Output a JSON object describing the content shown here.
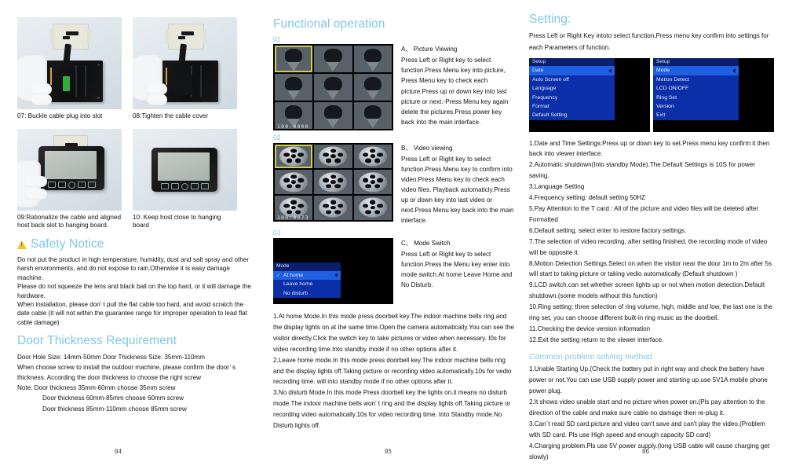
{
  "left_column": {
    "photos": [
      {
        "id": "07",
        "caption": "07:  Buckle cable plug into slot"
      },
      {
        "id": "08",
        "caption": "08:Tighten the cable cover"
      },
      {
        "id": "09",
        "caption": "09:Rationalize the cable and aligned host back slot to hanging board."
      },
      {
        "id": "10",
        "caption": "10: Keep host close to hanging board"
      }
    ],
    "safety": {
      "heading": "Safety Notice",
      "icon": "warning-triangle-icon",
      "paragraphs": [
        "Do not put the product in high temperature, humidity, dust and salt spray and other harsh environments, and do not expose to rain.Otherwise it is easy damage machine.",
        "Please do not squeeze the lens and black ball on the top hard, or it will damage the hardware.",
        "When installation, please don’ t pull the flat cable too hard, and avoid scratch the date cable (it will not within the guarantee range for improper operation to lead flat cable damage)"
      ]
    },
    "door": {
      "heading": "Door Thickness Requirement",
      "line1": "Door Hole Size: 14mm-50mm    Door Thickness Size: 35mm-110mm",
      "line2": "When choose screw to install the outdoor machine, please confirm the door’ s",
      "line3": "thickness. According the door thickness to choose the right screw",
      "note1": "Note:  Door thickness 35mm-60mm    choose 35mm screw",
      "note2": "Door thickness 60mm-85mm    choose 60mm screw",
      "note3": "Door thickness 85mm-110mm    choose 85mm screw"
    },
    "page_number": "04"
  },
  "mid_column": {
    "heading": "Functional operation",
    "sections": [
      {
        "step": "01",
        "screen_type": "picture-thumbnail-grid",
        "file_code": "100-0000",
        "title": "A、 Picture Viewing",
        "body": "Press Left or Right key to select function.Press Menu key into picture, Press Menu key to check each picture.Press up or down key into last picture or next.-Press Menu key again delete the pictures.Press power key back into the main interface."
      },
      {
        "step": "02",
        "screen_type": "video-thumbnail-grid",
        "file_code": "100-0073",
        "title": "B、 Video viewing",
        "body": "Press Left or Right key to select function.Press Menu key to confirm into video.Press Menu key to check each video files. Playback automaticly.Press up or down key into last video or next.Press Menu key back into the main interface."
      },
      {
        "step": "03",
        "screen_type": "mode-osd-menu",
        "osd": {
          "title": "Mode",
          "items": [
            {
              "label": "At home",
              "selected": true,
              "checked": true
            },
            {
              "label": "Leave home",
              "selected": false,
              "checked": false
            },
            {
              "label": "No disturb",
              "selected": false,
              "checked": false
            }
          ]
        },
        "title": "C、 Mode Switch",
        "body": "Press Left or Right key to select function.Press the Menu key enter  into mode switch.At home Leave Home and No Disturb."
      }
    ],
    "modes": [
      "1.At home Mode.In this mode press doorbell key.The indoor machine  bells ring.and the display lights on at the same time.Open the camera automatically.You can see the visitor directly.Click the switch key to take pictures or video when necessary. I0s for video recording time.Into standby mode if no other options after it.",
      "2.Leave home mode.In this mode press doorbell key.The indoor machine  bells ring and the display  lights off.Taking picture or recording video automatically.10s for vedio recording time. will into standby mode if no other options after it.",
      "3.No disturb Mode.In this mode Press doorbell key the lights on.it means  no disturb mode.The indoor machine bells won’ t ring and the display lights off.Taking picture or recording video automatically.10s for video recording time.  Into Standby mode.No Disturb lights off."
    ],
    "page_number": "05"
  },
  "right_column": {
    "heading": "Setting:",
    "intro": "Press Left or Right Key intoto select function,Press menu key confirm into settings for each  Parameters of function.",
    "menus": [
      {
        "title": "Setup",
        "items": [
          {
            "label": "Date",
            "selected": true
          },
          {
            "label": "Auto Screen off",
            "selected": false
          },
          {
            "label": "Language",
            "selected": false
          },
          {
            "label": "Frequency",
            "selected": false
          },
          {
            "label": "Format",
            "selected": false
          },
          {
            "label": "Default Setting",
            "selected": false
          }
        ]
      },
      {
        "title": "Setup",
        "items": [
          {
            "label": "Mode",
            "selected": true
          },
          {
            "label": "Motion Detect",
            "selected": false
          },
          {
            "label": "LCD ON/OFF",
            "selected": false
          },
          {
            "label": "Ring Set",
            "selected": false
          },
          {
            "label": "Version",
            "selected": false
          },
          {
            "label": "Exit",
            "selected": false
          }
        ]
      }
    ],
    "settings_list": [
      "1.Date and Time Settings:Press up or down key to set.Press menu key confirm it then back into viewer interface.",
      "2.Automatic shutdown(Into standby Mode).The Default Settings is 10S for power saving.",
      "3.Language Setting",
      "4.Frequency setting: default setting 50HZ",
      "5.Pay Attention to the T card : All of the picture and video files will be deleted after Formatted",
      "6.Default setting, select enter to restore factory settings.",
      "7.The selection of video recording, after setting finished, the recording mode of video will be opposite it.",
      "8.Motion Detection Settings.Select on.when the visitor near the door 1m to 2m after 5s will start to taking picture or taking   vedio automatically  (Default shutdown )",
      "9.LCD switch.can set whether screen lights up or not when motion detection.Default shutdown.(some models without this function)",
      "10.Ring setting: three selection of ring volume, high, middle and low, the last one is the ring set, you can choose different built-in ring music as the doorbell.",
      "11.Checking the device version information",
      "12.Exit the setting  return to the viewer interface."
    ],
    "problems_heading": "Common problem solving method",
    "problems_list": [
      "1.Unable Starting Up.(Check the battery put in right way and check the battery have power or not.You can use USB supply power and starting up.use 5V1A mobile phone power plug.",
      "2.It shows video unable start and no picture when power on.(Pls pay attention to the direction of the cable and make sure cable no damage then re-plug it.",
      "3.Can`t read SD card.picture and video can't save and can't play the video.(Problem with SD card. Pls use High speed and enough capacity SD card)",
      "4.Charging problem.Pls use 5V power supply.(long USB cable will cause charging get slowly)"
    ],
    "page_number": "06"
  },
  "colors": {
    "heading_blue": "#7ec8e8",
    "warning_yellow": "#f5c518",
    "osd_blue": "#0b2fa8",
    "osd_highlight": "#1f5fe0",
    "selection_outline": "#cfd14a"
  }
}
